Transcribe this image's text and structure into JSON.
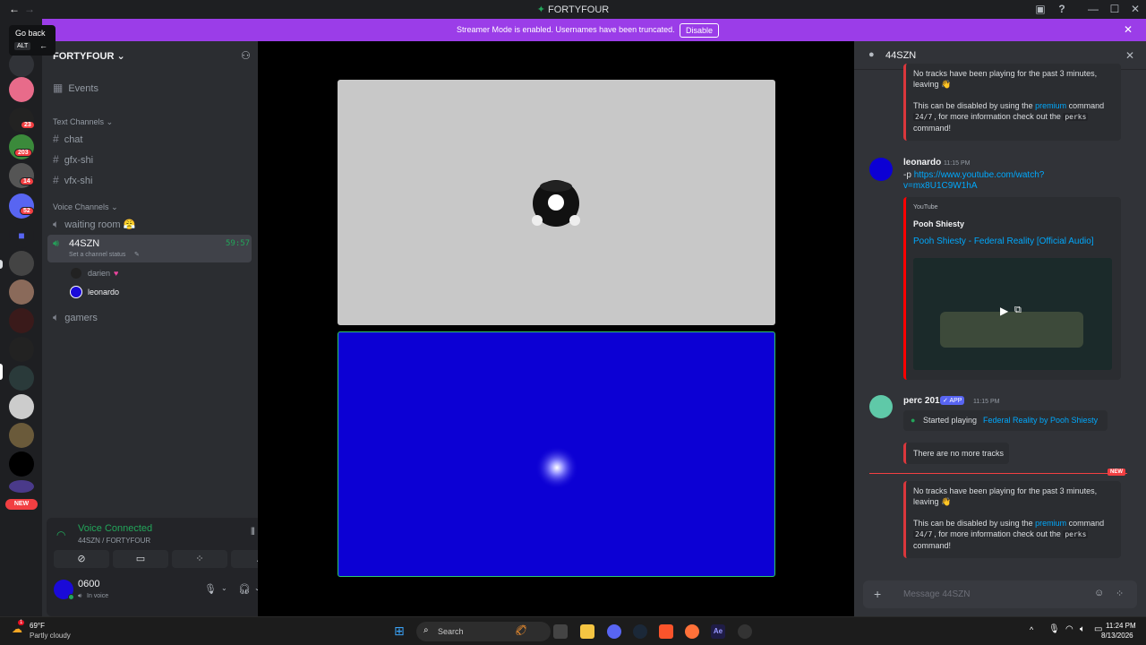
{
  "window": {
    "title": "FORTYFOUR",
    "back_label": "←",
    "forward_label": "→",
    "inbox_icon": "inbox-icon",
    "help_label": "?",
    "minimize_label": "—",
    "maximize_label": "☐",
    "close_label": "✕"
  },
  "tooltip": {
    "text": "Go back",
    "key": "ALT",
    "arrow": "←"
  },
  "banner": {
    "message": "Streamer Mode is enabled. Usernames have been truncated.",
    "button": "Disable",
    "close": "✕",
    "color": "#9b3de8"
  },
  "rail": {
    "badges": [
      "23",
      "203",
      "14",
      "52"
    ],
    "new_label": "NEW"
  },
  "sidebar": {
    "server_name": "FORTYFOUR",
    "events": "Events",
    "text_category": "Text Channels",
    "text_channels": [
      "chat",
      "gfx-shi",
      "vfx-shi"
    ],
    "voice_category": "Voice Channels",
    "voice_channels": {
      "waiting_room": "waiting room 😤",
      "active": "44SZN",
      "active_timer": "59:57",
      "active_status": "Set a channel status",
      "gamers": "gamers"
    },
    "voice_users": [
      "darien",
      "leonardo"
    ]
  },
  "voice_panel": {
    "status": "Voice Connected",
    "location": "44SZN / FORTYFOUR",
    "username": "0600",
    "user_status": "In voice"
  },
  "chat": {
    "channel": "44SZN",
    "messages": {
      "first_embed_line1": "No tracks have been playing for the past 3 minutes,",
      "first_embed_line2": "leaving 👋",
      "disable_pre": "This can be disabled by using the",
      "premium": "premium",
      "command_word": "command",
      "code_247": "24/7",
      "more_info": ", for more information check out the",
      "perks": "perks",
      "command_end": "command!",
      "leonardo_name": "leonardo",
      "leonardo_time": "11:15 PM",
      "leonardo_text_prefix": "-p",
      "leonardo_link1": "https://www.youtube.com/watch?",
      "leonardo_link2": "v=mx8U1C9W1hA",
      "yt_provider": "YouTube",
      "yt_author": "Pooh Shiesty",
      "yt_title": "Pooh Shiesty - Federal Reality [Official Audio]",
      "perc_name": "perc 201",
      "perc_app": "APP",
      "perc_time": "11:15 PM",
      "started_playing": "Started playing",
      "track": "Federal Reality by Pooh Shiesty",
      "no_more_tracks": "There are no more tracks",
      "new_label": "NEW"
    },
    "input_placeholder": "Message 44SZN"
  },
  "taskbar": {
    "weather_temp": "69°F",
    "weather_desc": "Partly cloudy",
    "weather_badge": "1",
    "search": "Search",
    "time": "11:24 PM",
    "date": "8/13/2026"
  },
  "colors": {
    "accent_green": "#23a55a",
    "stage_blue": "#0c00d4",
    "link": "#00a8fc",
    "danger": "#da373c"
  }
}
